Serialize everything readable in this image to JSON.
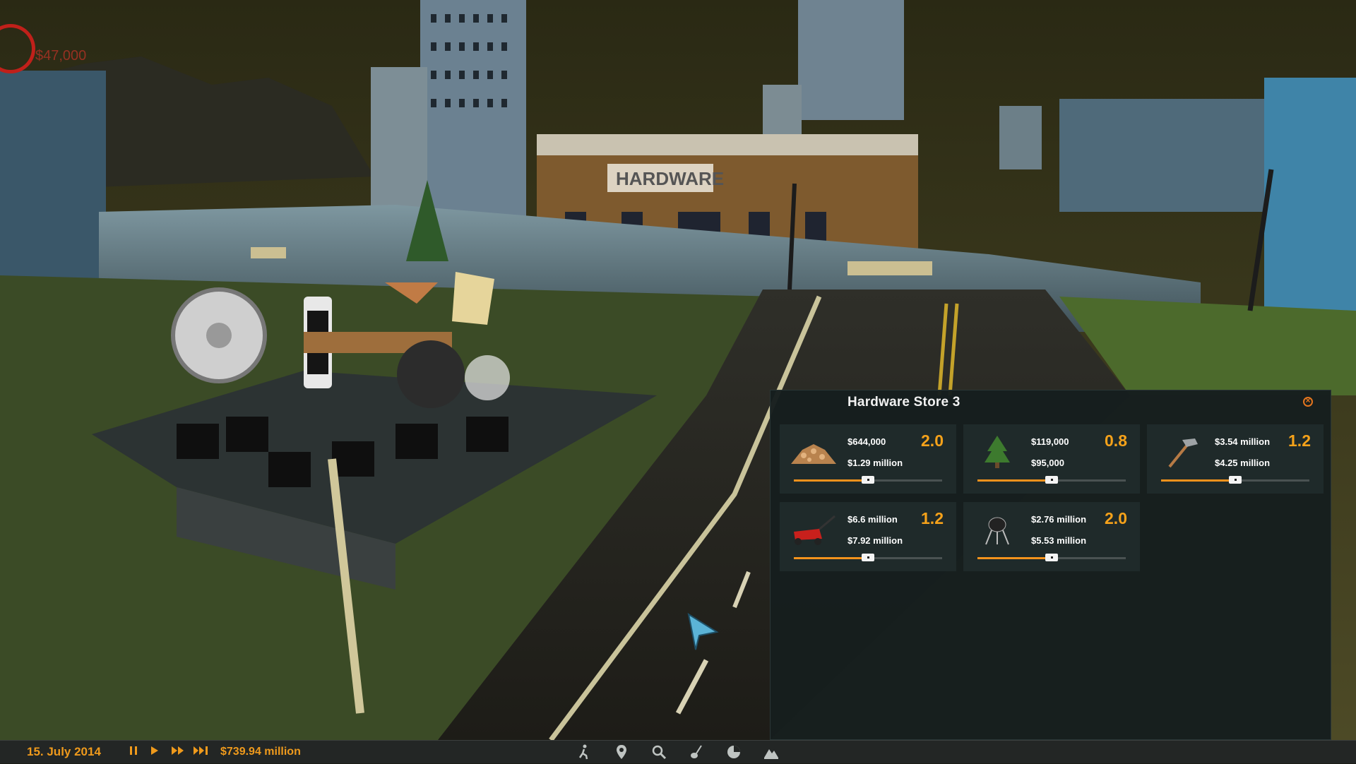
{
  "hud": {
    "money_indicator": "$47,000"
  },
  "scene": {
    "building_sign": "HARDWARE"
  },
  "store_panel": {
    "title": "Hardware Store 3",
    "close_icon": "close-circle-icon",
    "items": [
      {
        "icon": "wood-chips-icon",
        "price_top": "$644,000",
        "price_bottom": "$1.29 million",
        "factor": "2.0",
        "slider_level": 0.5
      },
      {
        "icon": "pine-tree-icon",
        "price_top": "$119,000",
        "price_bottom": "$95,000",
        "factor": "0.8",
        "slider_level": 0.5
      },
      {
        "icon": "hammer-icon",
        "price_top": "$3.54 million",
        "price_bottom": "$4.25 million",
        "factor": "1.2",
        "slider_level": 0.5
      },
      {
        "icon": "lawn-mower-icon",
        "price_top": "$6.6 million",
        "price_bottom": "$7.92 million",
        "factor": "1.2",
        "slider_level": 0.5
      },
      {
        "icon": "grill-icon",
        "price_top": "$2.76 million",
        "price_bottom": "$5.53 million",
        "factor": "2.0",
        "slider_level": 0.5
      }
    ]
  },
  "bottom_bar": {
    "date": "15. July 2014",
    "budget": "$739.94 million",
    "time_controls": [
      "pause-icon",
      "play-icon",
      "fast-forward-icon",
      "fastest-forward-icon"
    ],
    "tools": [
      "walker-icon",
      "map-pin-icon",
      "magnifier-icon",
      "guitar-icon",
      "pie-chart-icon",
      "terrain-icon"
    ]
  },
  "colors": {
    "accent": "#ef9a1c",
    "panel_bg": "#161e1e",
    "card_bg": "#1f2a2a",
    "factor_text": "#f6a21a"
  }
}
